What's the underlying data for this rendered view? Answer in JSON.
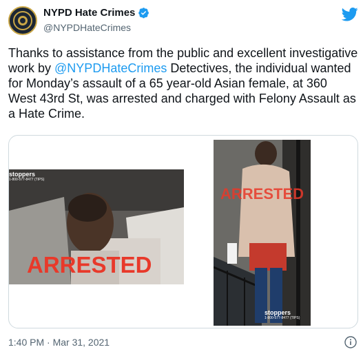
{
  "account": {
    "display_name": "NYPD Hate Crimes",
    "handle": "@NYPDHateCrimes"
  },
  "tweet": {
    "text_before": "Thanks to assistance from the public and excellent investigative work by ",
    "mention": "@NYPDHateCrimes",
    "text_after": " Detectives, the individual wanted for Monday’s assault of a 65 year-old Asian female, at 360 West 43rd St, was arrested and charged with Felony Assault as a Hate Crime."
  },
  "media": {
    "photo1_stamp": "ARRESTED",
    "photo2_stamp": "ARRESTED",
    "crimestoppers_label": "stoppers",
    "crimestoppers_phone": "1-800-577-8477 (TIPS)"
  },
  "footer": {
    "timestamp": "1:40 PM · Mar 31, 2021"
  },
  "colors": {
    "link": "#1d9bf0",
    "stamp": "#e8392a",
    "verified": "#1d9bf0"
  },
  "icons": [
    "nypd-badge-icon",
    "verified-badge-icon",
    "twitter-bird-icon",
    "info-icon"
  ]
}
